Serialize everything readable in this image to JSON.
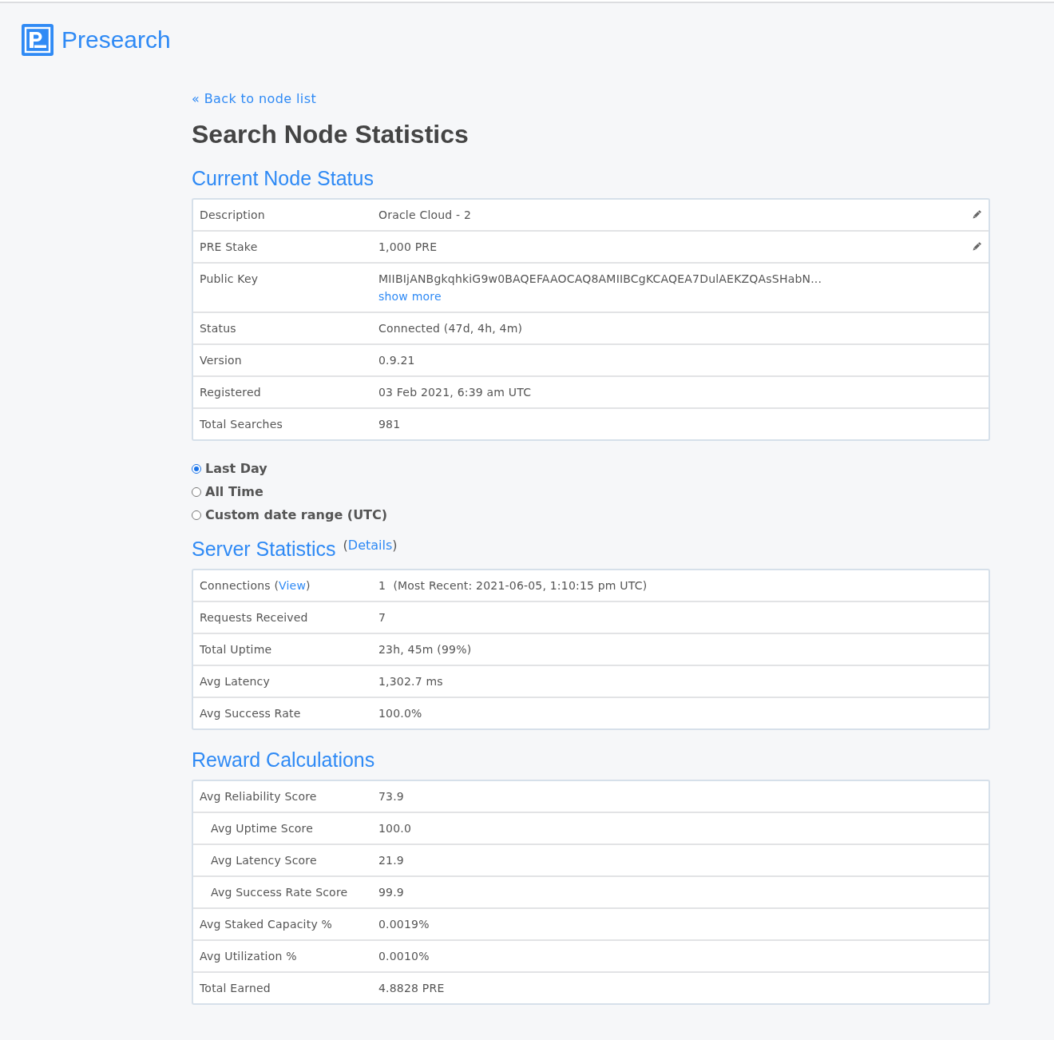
{
  "brand": {
    "name": "Presearch"
  },
  "back_link": "« Back to node list",
  "title": "Search Node Statistics",
  "node_status": {
    "heading": "Current Node Status",
    "rows": [
      {
        "label": "Description",
        "value": "Oracle Cloud - 2",
        "editable": true
      },
      {
        "label": "PRE Stake",
        "value": "1,000 PRE",
        "editable": true
      },
      {
        "label": "Public Key",
        "value": "MIIBIjANBgkqhkiG9w0BAQEFAAOCAQ8AMIIBCgKCAQEA7DulAEKZQAsSHabN...",
        "link": "show more",
        "editable": false
      },
      {
        "label": "Status",
        "value": "Connected (47d, 4h, 4m)",
        "editable": false
      },
      {
        "label": "Version",
        "value": "0.9.21",
        "editable": false
      },
      {
        "label": "Registered",
        "value": "03 Feb 2021, 6:39 am UTC",
        "editable": false
      },
      {
        "label": "Total Searches",
        "value": "981",
        "editable": false
      }
    ]
  },
  "time_range": {
    "options": [
      {
        "label": "Last Day",
        "selected": true
      },
      {
        "label": "All Time",
        "selected": false
      },
      {
        "label": "Custom date range (UTC)",
        "selected": false
      }
    ]
  },
  "server_statistics": {
    "heading": "Server Statistics",
    "heading_note": {
      "open": "(",
      "link": "Details",
      "close": ")"
    },
    "rows": [
      {
        "label": "Connections",
        "label_note": {
          "open": "(",
          "link": "View",
          "close": ")"
        },
        "value": "1  (Most Recent: 2021-06-05, 1:10:15 pm UTC)"
      },
      {
        "label": "Requests Received",
        "value": "7"
      },
      {
        "label": "Total Uptime",
        "value": "23h, 45m (99%)"
      },
      {
        "label": "Avg Latency",
        "value": "1,302.7 ms"
      },
      {
        "label": "Avg Success Rate",
        "value": "100.0%"
      }
    ]
  },
  "reward_calculations": {
    "heading": "Reward Calculations",
    "rows": [
      {
        "label": "Avg Reliability Score",
        "value": "73.9",
        "children": [
          {
            "label": "Avg Uptime Score",
            "value": "100.0"
          },
          {
            "label": "Avg Latency Score",
            "value": "21.9"
          },
          {
            "label": "Avg Success Rate Score",
            "value": "99.9"
          }
        ]
      },
      {
        "label": "Avg Staked Capacity %",
        "value": "0.0019%"
      },
      {
        "label": "Avg Utilization %",
        "value": "0.0010%"
      },
      {
        "label": "Total Earned",
        "value": "4.8828 PRE"
      }
    ]
  }
}
